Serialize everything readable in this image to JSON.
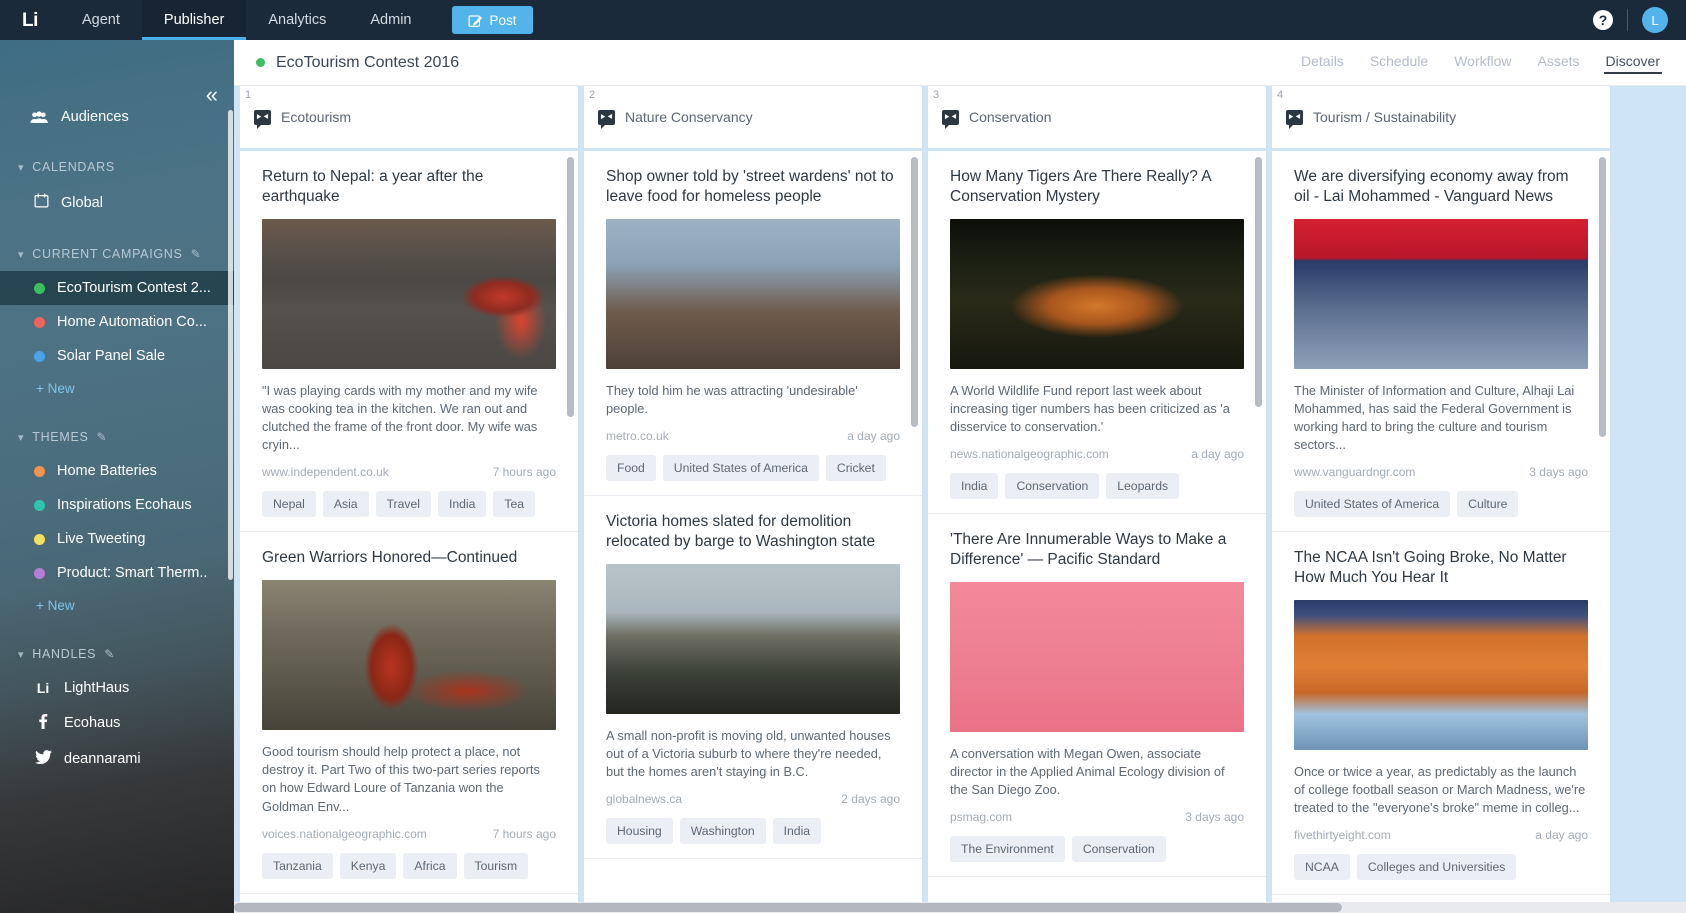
{
  "topnav": {
    "logo": "Li",
    "items": [
      {
        "label": "Agent",
        "active": false
      },
      {
        "label": "Publisher",
        "active": true
      },
      {
        "label": "Analytics",
        "active": false
      },
      {
        "label": "Admin",
        "active": false
      }
    ],
    "post_button": "Post",
    "help_icon": "question-mark-icon",
    "avatar_initial": "L"
  },
  "sidebar": {
    "collapse_icon": "«",
    "audiences": {
      "label": "Audiences",
      "icon": "people-icon"
    },
    "calendars": {
      "header": "CALENDARS",
      "items": [
        {
          "label": "Global",
          "icon": "calendar-icon"
        }
      ]
    },
    "current_campaigns": {
      "header": "CURRENT CAMPAIGNS",
      "edit_icon": "pencil-icon",
      "items": [
        {
          "label": "EcoTourism Contest 2...",
          "color": "#3cbf5e",
          "selected": true
        },
        {
          "label": "Home Automation Co...",
          "color": "#f0635a",
          "selected": false
        },
        {
          "label": "Solar Panel Sale",
          "color": "#4aa3e8",
          "selected": false
        }
      ],
      "new_label": "+ New"
    },
    "themes": {
      "header": "THEMES",
      "edit_icon": "pencil-icon",
      "items": [
        {
          "label": "Home Batteries",
          "color": "#f0944f"
        },
        {
          "label": "Inspirations Ecohaus",
          "color": "#2ec4b0"
        },
        {
          "label": "Live Tweeting",
          "color": "#f2e060"
        },
        {
          "label": "Product: Smart Therm..",
          "color": "#b57fd4"
        }
      ],
      "new_label": "+ New"
    },
    "handles": {
      "header": "HANDLES",
      "edit_icon": "pencil-icon",
      "items": [
        {
          "label": "LightHaus",
          "icon": "lithium-icon",
          "glyph": "Li"
        },
        {
          "label": "Ecohaus",
          "icon": "facebook-icon",
          "glyph": "f"
        },
        {
          "label": "deannarami",
          "icon": "twitter-icon",
          "glyph": "ᵥ"
        }
      ]
    }
  },
  "content_header": {
    "status_color": "#3cbf5e",
    "title": "EcoTourism Contest 2016",
    "tabs": [
      {
        "label": "Details",
        "active": false
      },
      {
        "label": "Schedule",
        "active": false
      },
      {
        "label": "Workflow",
        "active": false
      },
      {
        "label": "Assets",
        "active": false
      },
      {
        "label": "Discover",
        "active": true
      }
    ]
  },
  "board": {
    "columns": [
      {
        "number": "1",
        "title": "Ecotourism",
        "badge_icon": "stream-badge-icon",
        "cards": [
          {
            "title": "Return to Nepal: a year after the earthquake",
            "image_class": "img-nepal",
            "description": "\"I was playing cards with my mother and my wife was cooking tea in the kitchen. We ran out and clutched the frame of the front door. My wife was cryin...",
            "source": "www.independent.co.uk",
            "time": "7 hours ago",
            "tags": [
              "Nepal",
              "Asia",
              "Travel",
              "India",
              "Tea"
            ]
          },
          {
            "title": "Green Warriors Honored—Continued",
            "image_class": "img-warriors",
            "description": "Good tourism should help protect a place, not destroy it. Part Two of this two-part series reports on how Edward Loure of Tanzania won the Goldman Env...",
            "source": "voices.nationalgeographic.com",
            "time": "7 hours ago",
            "tags": [
              "Tanzania",
              "Kenya",
              "Africa",
              "Tourism"
            ]
          }
        ]
      },
      {
        "number": "2",
        "title": "Nature Conservancy",
        "badge_icon": "stream-badge-icon",
        "cards": [
          {
            "title": "Shop owner told by 'street wardens' not to leave food for homeless people",
            "image_class": "img-shop",
            "description": "They told him he was attracting 'undesirable' people.",
            "source": "metro.co.uk",
            "time": "a day ago",
            "tags": [
              "Food",
              "United States of America",
              "Cricket"
            ]
          },
          {
            "title": "Victoria homes slated for demolition relocated by barge to Washington state",
            "image_class": "img-victoria",
            "description": "A small non-profit is moving old, unwanted houses out of a Victoria suburb to where they're needed, but the homes aren't staying in B.C.",
            "source": "globalnews.ca",
            "time": "2 days ago",
            "tags": [
              "Housing",
              "Washington",
              "India"
            ]
          }
        ]
      },
      {
        "number": "3",
        "title": "Conservation",
        "badge_icon": "stream-badge-icon",
        "cards": [
          {
            "title": "How Many Tigers Are There Really? A Conservation Mystery",
            "image_class": "img-tiger",
            "description": "A World Wildlife Fund report last week about increasing tiger numbers has been criticized as 'a disservice to conservation.'",
            "source": "news.nationalgeographic.com",
            "time": "a day ago",
            "tags": [
              "India",
              "Conservation",
              "Leopards"
            ]
          },
          {
            "title": "'There Are Innumerable Ways to Make a Difference' — Pacific Standard",
            "image_class": "img-pink",
            "description": "A conversation with Megan Owen, associate director in the Applied Animal Ecology division of the San Diego Zoo.",
            "source": "psmag.com",
            "time": "3 days ago",
            "tags": [
              "The Environment",
              "Conservation"
            ]
          }
        ]
      },
      {
        "number": "4",
        "title": "Tourism / Sustainability",
        "badge_icon": "stream-badge-icon",
        "cards": [
          {
            "title": "We are diversifying economy away from oil - Lai Mohammed - Vanguard News",
            "image_class": "img-vanguard",
            "description": "The Minister of Information and Culture, Alhaji Lai Mohammed, has said the Federal Government is working hard to bring the culture and tourism sectors...",
            "source": "www.vanguardngr.com",
            "time": "3 days ago",
            "tags": [
              "United States of America",
              "Culture"
            ]
          },
          {
            "title": "The NCAA Isn't Going Broke, No Matter How Much You Hear It",
            "image_class": "img-ncaa",
            "description": "Once or twice a year, as predictably as the launch of college football season or March Madness, we're treated to the \"everyone's broke\" meme in colleg...",
            "source": "fivethirtyeight.com",
            "time": "a day ago",
            "tags": [
              "NCAA",
              "Colleges and Universities"
            ]
          }
        ]
      }
    ]
  }
}
